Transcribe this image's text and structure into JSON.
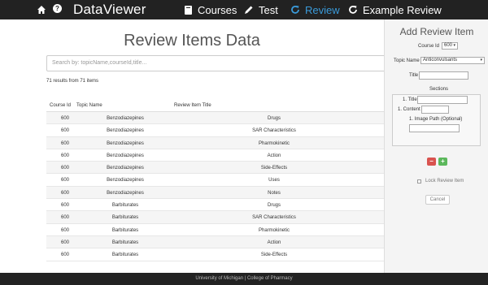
{
  "navbar": {
    "brand": "DataViewer",
    "items": [
      {
        "label": "Courses",
        "icon": "book-icon"
      },
      {
        "label": "Test",
        "icon": "pencil-icon"
      },
      {
        "label": "Review",
        "icon": "refresh-icon",
        "active": true
      },
      {
        "label": "Example Review",
        "icon": "refresh-icon"
      }
    ],
    "active_color": "#3a9ad9"
  },
  "main": {
    "title": "Review Items Data",
    "search_placeholder": "Search by: topicName,courseId,title...",
    "results_text": "71 results from 71 items",
    "columns": [
      "Course Id",
      "Topic Name",
      "Review Item Title"
    ],
    "rows": [
      {
        "course": "600",
        "topic": "Benzodiazepines",
        "title": "Drugs"
      },
      {
        "course": "600",
        "topic": "Benzodiazepines",
        "title": "SAR Characteristics"
      },
      {
        "course": "600",
        "topic": "Benzodiazepines",
        "title": "Pharmokinetic"
      },
      {
        "course": "600",
        "topic": "Benzodiazepines",
        "title": "Action"
      },
      {
        "course": "600",
        "topic": "Benzodiazepines",
        "title": "Side-Effects"
      },
      {
        "course": "600",
        "topic": "Benzodiazepines",
        "title": "Uses"
      },
      {
        "course": "600",
        "topic": "Benzodiazepines",
        "title": "Notes"
      },
      {
        "course": "600",
        "topic": "Barbiturates",
        "title": "Drugs"
      },
      {
        "course": "600",
        "topic": "Barbiturates",
        "title": "SAR Characteristics"
      },
      {
        "course": "600",
        "topic": "Barbiturates",
        "title": "Pharmokinetic"
      },
      {
        "course": "600",
        "topic": "Barbiturates",
        "title": "Action"
      },
      {
        "course": "600",
        "topic": "Barbiturates",
        "title": "Side-Effects"
      }
    ]
  },
  "panel": {
    "title": "Add Review Item",
    "course_label": "Course Id",
    "course_value": "600",
    "topic_label": "Topic Name",
    "topic_value": "Anticonvulsants",
    "title_label": "Title",
    "sections_label": "Sections",
    "section_title_label": "1. Title",
    "section_content_label": "1. Content",
    "section_image_label": "1. Image Path (Optional)",
    "minus_label": "−",
    "plus_label": "+",
    "lock_label": "Lock Review Item",
    "cancel_label": "Cancel",
    "minus_color": "#d9534f",
    "plus_color": "#5cb85c"
  },
  "footer": {
    "text": "University of Michigan | College of Pharmacy"
  }
}
